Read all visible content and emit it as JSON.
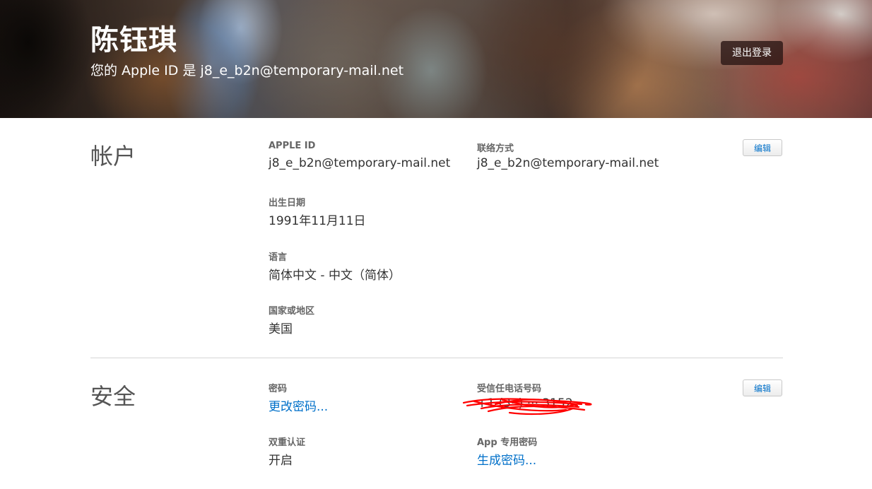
{
  "header": {
    "name": "陈钰琪",
    "apple_id_line": "您的 Apple ID 是 j8_e_b2n@temporary-mail.net",
    "sign_out_label": "退出登录"
  },
  "account": {
    "title": "帐户",
    "edit_label": "编辑",
    "apple_id": {
      "label": "APPLE ID",
      "value": "j8_e_b2n@temporary-mail.net"
    },
    "contact": {
      "label": "联络方式",
      "value": "j8_e_b2n@temporary-mail.net"
    },
    "birthday": {
      "label": "出生日期",
      "value": "1991年11月11日"
    },
    "language": {
      "label": "语言",
      "value": "简体中文 - 中文（简体）"
    },
    "region": {
      "label": "国家或地区",
      "value": "美国"
    }
  },
  "security": {
    "title": "安全",
    "edit_label": "编辑",
    "password": {
      "label": "密码",
      "link": "更改密码..."
    },
    "trusted_phone": {
      "label": "受信任电话号码",
      "value": "+1 (3··) ··· 3152"
    },
    "two_factor": {
      "label": "双重认证",
      "value": "开启"
    },
    "app_password": {
      "label": "App 专用密码",
      "link": "生成密码..."
    }
  },
  "colors": {
    "link": "#0070c9",
    "redaction_scribble": "#ff0000"
  }
}
